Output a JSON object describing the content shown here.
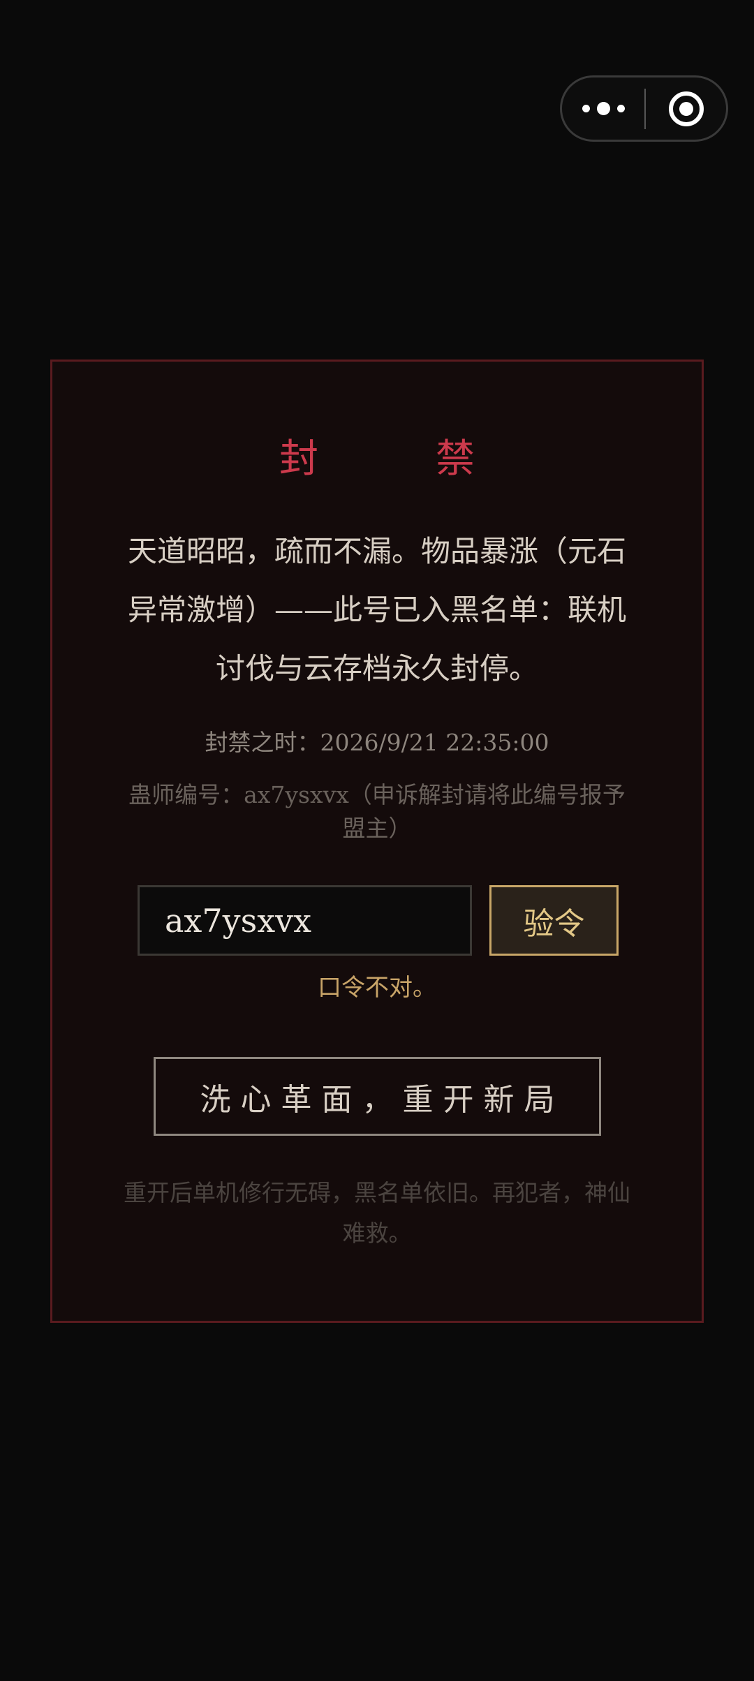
{
  "capsule": {
    "more_icon": "more-dots-icon",
    "close_icon": "target-circle-icon"
  },
  "dialog": {
    "title": "封　禁",
    "message": "天道昭昭，疏而不漏。物品暴涨（元石异常激增）——此号已入黑名单：联机讨伐与云存档永久封停。",
    "ban_time_label": "封禁之时：",
    "ban_time_value": "2026/9/21 22:35:00",
    "account_label": "蛊师编号：",
    "account_id": "ax7ysxvx",
    "account_hint": "（申诉解封请将此编号报予盟主）",
    "code_input_value": "ax7ysxvx",
    "verify_label": "验令",
    "error_text": "口令不对。",
    "restart_label": "洗心革面，重开新局",
    "footer_note": "重开后单机修行无碍，黑名单依旧。再犯者，神仙难救。"
  },
  "colors": {
    "background": "#0a0a0a",
    "panel": "#140b0b",
    "panel_border": "#5a1b1f",
    "title": "#cc3a4c",
    "accent_gold": "#c9a768"
  }
}
